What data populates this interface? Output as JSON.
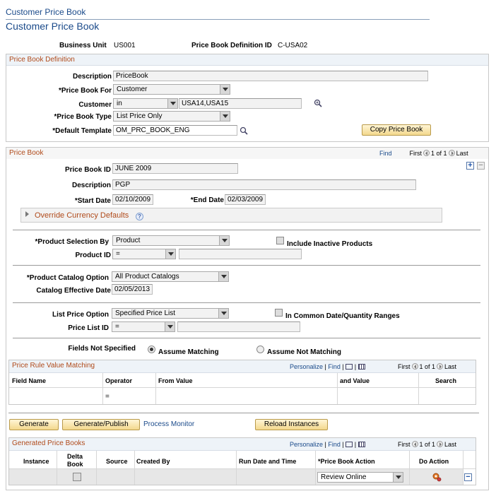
{
  "breadcrumb": "Customer Price Book",
  "page_title": "Customer Price Book",
  "header": {
    "business_unit_label": "Business Unit",
    "business_unit_value": "US001",
    "definition_id_label": "Price Book Definition ID",
    "definition_id_value": "C-USA02"
  },
  "definition": {
    "title": "Price Book Definition",
    "description_label": "Description",
    "description_value": "PriceBook",
    "for_label": "*Price Book For",
    "for_value": "Customer",
    "customer_label": "Customer",
    "customer_operator": "in",
    "customer_value": "USA14,USA15",
    "type_label": "*Price Book Type",
    "type_value": "List Price Only",
    "template_label": "*Default Template",
    "template_value": "OM_PRC_BOOK_ENG",
    "copy_button": "Copy Price Book"
  },
  "pricebook": {
    "title": "Price Book",
    "find": "Find",
    "first": "First",
    "count": "1 of 1",
    "last": "Last",
    "id_label": "Price Book ID",
    "id_value": "JUNE 2009",
    "description_label": "Description",
    "description_value": "PGP",
    "start_label": "*Start Date",
    "start_value": "02/10/2009",
    "end_label": "*End Date",
    "end_value": "02/03/2009",
    "override_currency": "Override Currency Defaults",
    "product_selection_label": "*Product Selection By",
    "product_selection_value": "Product",
    "include_inactive_label": "Include Inactive Products",
    "product_id_label": "Product ID",
    "product_id_operator": "=",
    "catalog_option_label": "*Product Catalog Option",
    "catalog_option_value": "All Product Catalogs",
    "catalog_date_label": "Catalog Effective Date",
    "catalog_date_value": "02/05/2013",
    "list_price_option_label": "List Price Option",
    "list_price_option_value": "Specified Price List",
    "common_date_label": "In Common Date/Quantity Ranges",
    "price_list_id_label": "Price List ID",
    "price_list_id_operator": "=",
    "fields_not_specified_label": "Fields Not Specified",
    "assume_matching": "Assume Matching",
    "assume_not_matching": "Assume Not Matching"
  },
  "rule_grid": {
    "title": "Price Rule Value Matching",
    "personalize": "Personalize",
    "find": "Find",
    "first": "First",
    "count": "1 of 1",
    "last": "Last",
    "columns": [
      "Field Name",
      "Operator",
      "From Value",
      "and Value",
      "Search"
    ],
    "row_operator": "="
  },
  "actions": {
    "generate": "Generate",
    "generate_publish": "Generate/Publish",
    "process_monitor": "Process Monitor",
    "reload_instances": "Reload Instances"
  },
  "generated_grid": {
    "title": "Generated Price Books",
    "personalize": "Personalize",
    "find": "Find",
    "first": "First",
    "count": "1 of 1",
    "last": "Last",
    "col_instance": "Instance",
    "col_delta_line1": "Delta",
    "col_delta_line2": "Book",
    "col_source": "Source",
    "col_created_by": "Created By",
    "col_run_date": "Run Date and Time",
    "col_action": "*Price Book Action",
    "col_do_action": "Do Action",
    "row_action_value": "Review Online"
  }
}
